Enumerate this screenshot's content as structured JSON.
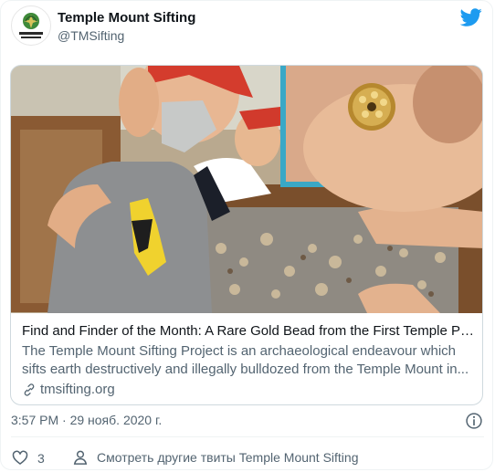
{
  "author": {
    "name": "Temple Mount Sifting",
    "handle": "@TMSifting",
    "avatar_text": "TEMPLE MOUNT SIFTING PROJECT"
  },
  "card": {
    "title": "Find and Finder of the Month: A Rare Gold Bead from the First Temple Pe...",
    "description": "The Temple Mount Sifting Project is an archaeological endeavour which sifts earth destructively and illegally bulldozed from the Temple Mount in...",
    "domain": "tmsifting.org"
  },
  "timestamp": "3:57 PM · 29 нояб. 2020 г.",
  "actions": {
    "like_count": "3",
    "more_tweets_label": "Смотреть другие твиты Temple Mount Sifting"
  },
  "colors": {
    "twitter_blue": "#1d9bf0",
    "text_primary": "#0f1419",
    "text_secondary": "#536471",
    "border": "#cfd9de",
    "inset_frame": "#3aa8c6"
  },
  "icons": [
    "avatar-logo-icon",
    "twitter-bird-icon",
    "link-icon",
    "info-icon",
    "heart-icon",
    "person-icon"
  ]
}
